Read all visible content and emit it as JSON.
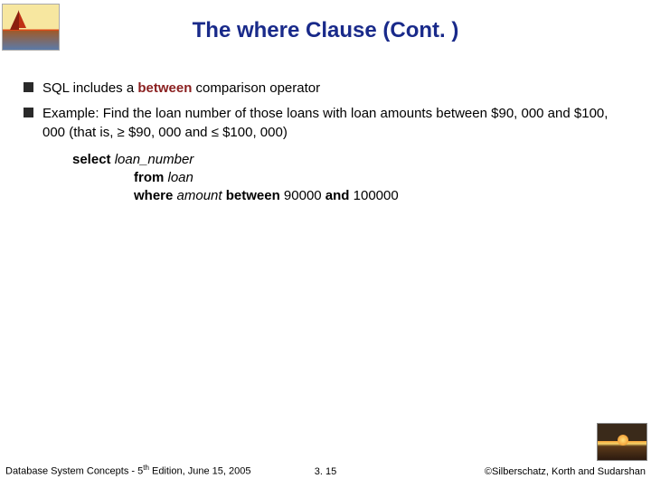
{
  "title": "The where Clause (Cont. )",
  "bullets": {
    "b1": {
      "pre": "SQL includes a ",
      "kw": "between",
      "post": " comparison operator"
    },
    "b2": {
      "text": "Example:  Find the loan number of those loans with loan amounts between $90, 000 and $100, 000 (that is, ≥ $90, 000 and ≤ $100, 000)"
    }
  },
  "code": {
    "l1_kw": "select",
    "l1_id": " loan_number",
    "l2_kw": "from",
    "l2_id": " loan",
    "l3_kw1": "where",
    "l3_id": " amount ",
    "l3_kw2": "between",
    "l3_mid": " 90000 ",
    "l3_kw3": "and",
    "l3_end": " 100000"
  },
  "footer": {
    "left_pre": "Database System Concepts - 5",
    "left_sup": "th",
    "left_post": " Edition, June 15, 2005",
    "center": "3. 15",
    "right": "©Silberschatz, Korth and Sudarshan"
  }
}
